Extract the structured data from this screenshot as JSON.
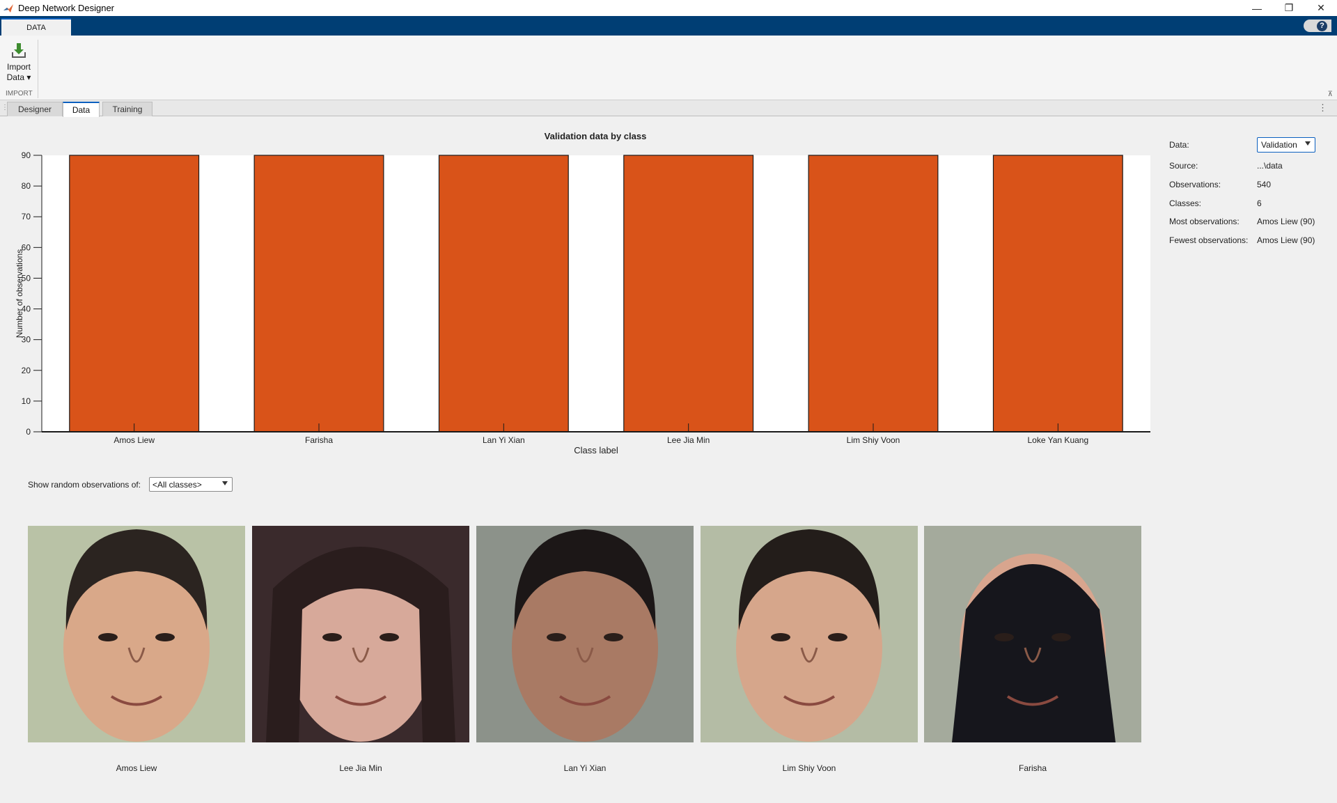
{
  "window": {
    "title": "Deep Network Designer",
    "minimize": "—",
    "restore": "❐",
    "close": "✕"
  },
  "ribbon": {
    "tab_label": "DATA",
    "help_label": "?",
    "import_button": {
      "line1": "Import",
      "line2": "Data ▾"
    },
    "group_label": "IMPORT",
    "collapse": "⊼"
  },
  "doc_tabs": [
    {
      "label": "Designer",
      "active": false
    },
    {
      "label": "Data",
      "active": true
    },
    {
      "label": "Training",
      "active": false
    }
  ],
  "chart_data": {
    "type": "bar",
    "title": "Validation data by class",
    "xlabel": "Class label",
    "ylabel": "Number of observations",
    "categories": [
      "Amos Liew",
      "Farisha",
      "Lan Yi Xian",
      "Lee Jia Min",
      "Lim Shiy Voon",
      "Loke Yan Kuang"
    ],
    "values": [
      90,
      90,
      90,
      90,
      90,
      90
    ],
    "ylim": [
      0,
      90
    ],
    "yticks": [
      0,
      10,
      20,
      30,
      40,
      50,
      60,
      70,
      80,
      90
    ],
    "bar_color": "#d95319",
    "grid": false
  },
  "summary": {
    "data_label": "Data:",
    "data_value": "Validation",
    "source_label": "Source:",
    "source_value": "...\\data",
    "observations_label": "Observations:",
    "observations_value": "540",
    "classes_label": "Classes:",
    "classes_value": "6",
    "most_label": "Most observations:",
    "most_value": "Amos Liew (90)",
    "fewest_label": "Fewest observations:",
    "fewest_value": "Amos Liew (90)"
  },
  "random_obs": {
    "label": "Show random observations of:",
    "selected": "<All classes>",
    "images": [
      {
        "caption": "Amos Liew",
        "bg": "#b9c2a6",
        "skin": "#d9a889",
        "hair": "#2b2420",
        "style": "short"
      },
      {
        "caption": "Lee Jia Min",
        "bg": "#3a2a2c",
        "skin": "#d7a99a",
        "hair": "#2a1d1d",
        "style": "long"
      },
      {
        "caption": "Lan Yi Xian",
        "bg": "#8c928a",
        "skin": "#a97a64",
        "hair": "#1c1717",
        "style": "short"
      },
      {
        "caption": "Lim Shiy Voon",
        "bg": "#b4bca5",
        "skin": "#d6a68b",
        "hair": "#231d1a",
        "style": "short"
      },
      {
        "caption": "Farisha",
        "bg": "#a4aa9c",
        "skin": "#d8a58e",
        "hair": "#16161c",
        "style": "hijab"
      }
    ]
  }
}
